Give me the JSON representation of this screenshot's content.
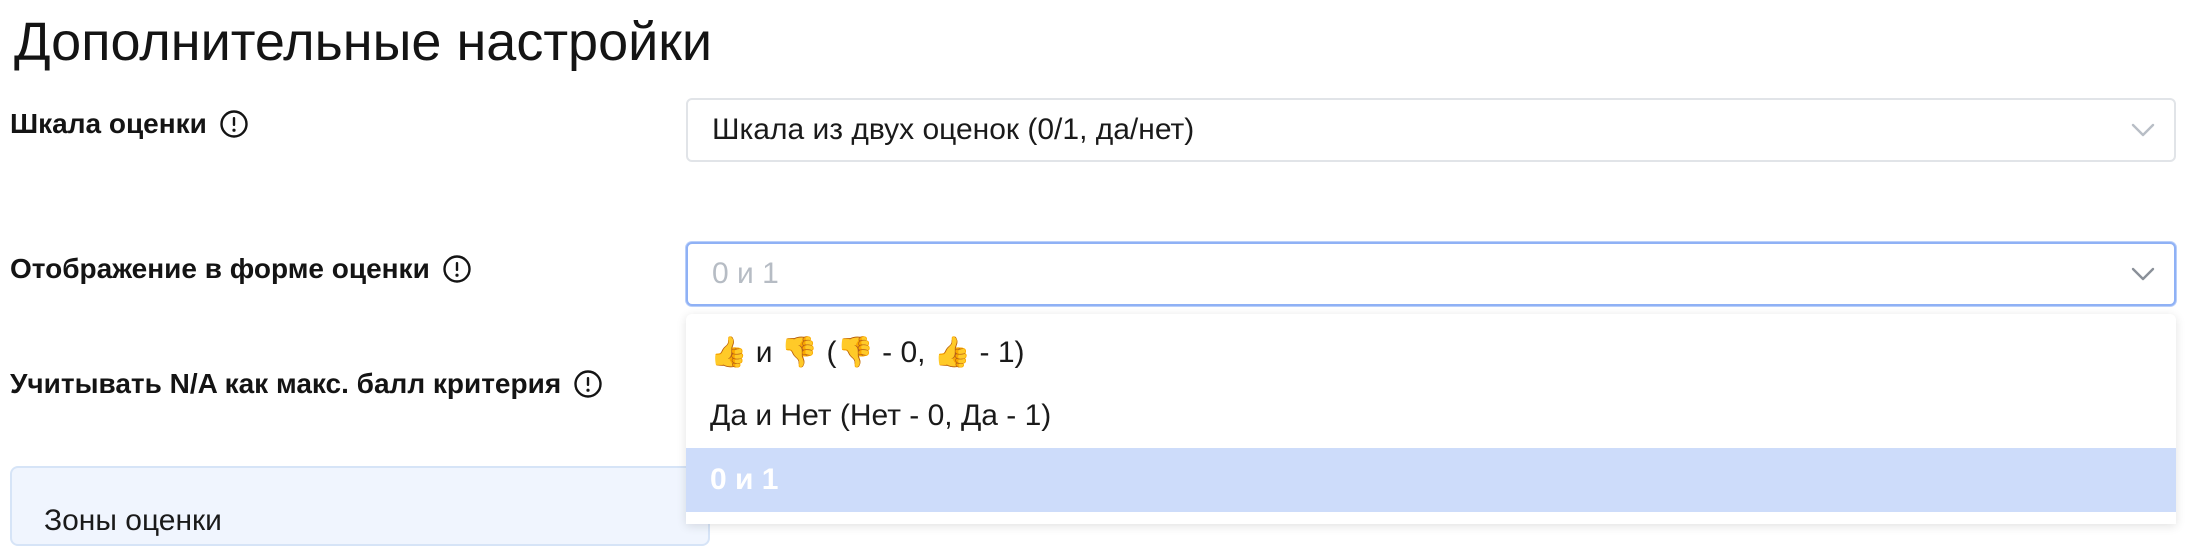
{
  "page": {
    "title": "Дополнительные настройки"
  },
  "fields": {
    "scale": {
      "label": "Шкала оценки",
      "value": "Шкала из двух оценок (0/1, да/нет)"
    },
    "display": {
      "label": "Отображение в форме оценки",
      "placeholder": "0 и 1"
    },
    "na_max": {
      "label": "Учитывать N/A как макс. балл критерия"
    }
  },
  "dropdown": {
    "options": [
      {
        "label": "👍 и 👎 (👎 - 0, 👍 - 1)",
        "selected": false
      },
      {
        "label": "Да и Нет (Нет - 0, Да - 1)",
        "selected": false
      },
      {
        "label": "0 и 1",
        "selected": true
      }
    ]
  },
  "zones": {
    "title": "Зоны оценки"
  },
  "colors": {
    "focus_border": "#8fb1f5",
    "selected_option_bg": "#cddcfa",
    "panel_bg": "#f0f5fe",
    "placeholder_text": "#b6bcc4"
  },
  "icons": {
    "info": "info-circle-icon",
    "chevron": "chevron-down-icon"
  }
}
